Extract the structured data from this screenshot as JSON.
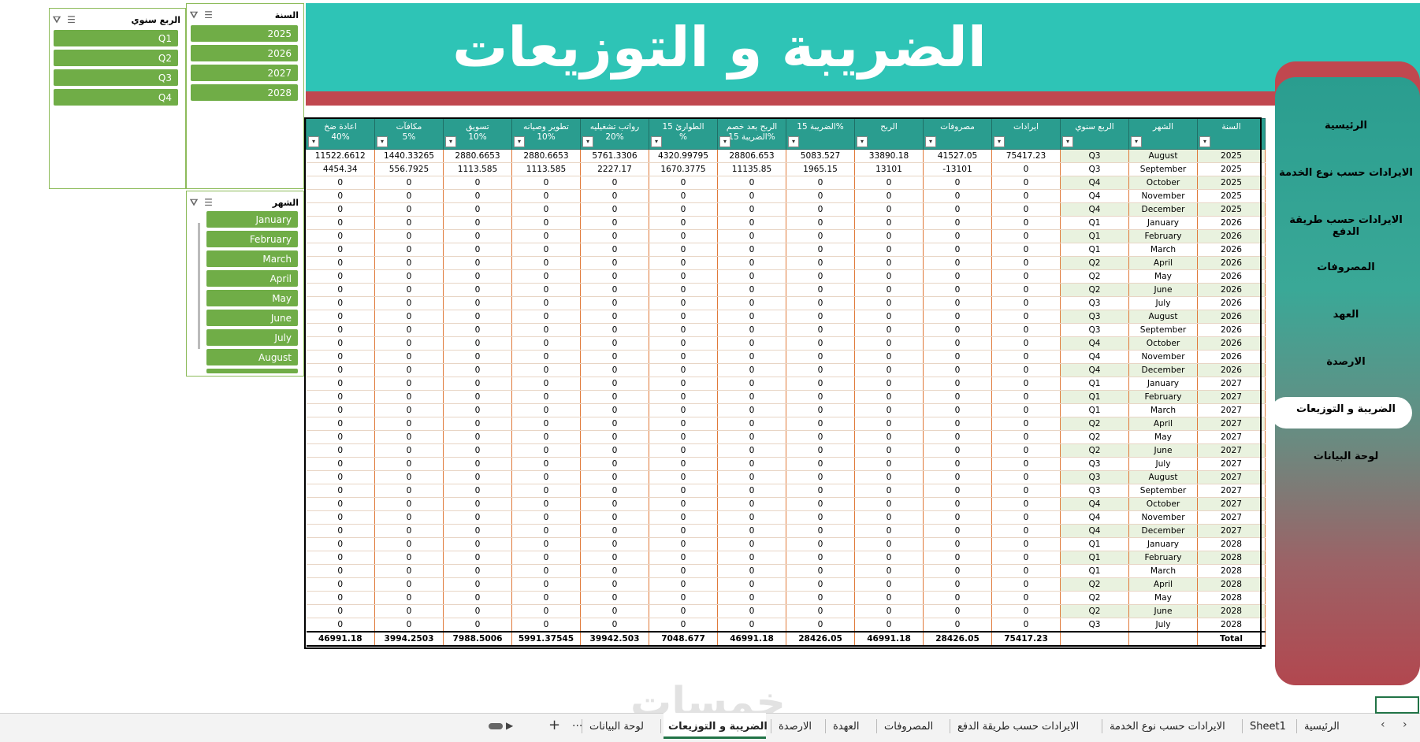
{
  "header": {
    "title": "الضريبة و التوزيعات"
  },
  "slicers": {
    "quarter": {
      "title": "الربع سنوي",
      "items": [
        "Q1",
        "Q2",
        "Q3",
        "Q4"
      ]
    },
    "year": {
      "title": "السنة",
      "items": [
        "2025",
        "2026",
        "2027",
        "2028"
      ]
    },
    "month": {
      "title": "الشهر",
      "items": [
        "January",
        "February",
        "March",
        "April",
        "May",
        "June",
        "July",
        "August"
      ]
    }
  },
  "table": {
    "headers": [
      {
        "l1": "السنة",
        "l2": ""
      },
      {
        "l1": "الشهر",
        "l2": ""
      },
      {
        "l1": "الربع سنوي",
        "l2": ""
      },
      {
        "l1": "ايرادات",
        "l2": ""
      },
      {
        "l1": "مصروفات",
        "l2": ""
      },
      {
        "l1": "الربح",
        "l2": ""
      },
      {
        "l1": "الضريبة 15%",
        "l2": ""
      },
      {
        "l1": "الربح بعد خصم",
        "l2": "الضريبة 15%"
      },
      {
        "l1": "الطوارئ 15",
        "l2": "%"
      },
      {
        "l1": "رواتب تشغيليه",
        "l2": "20%"
      },
      {
        "l1": "تطوير وصيانه",
        "l2": "10%"
      },
      {
        "l1": "تسويق",
        "l2": "10%"
      },
      {
        "l1": "مكافآت",
        "l2": "5%"
      },
      {
        "l1": "اعادة ضخ",
        "l2": "40%"
      }
    ],
    "rows": [
      [
        "2025",
        "August",
        "Q3",
        "75417.23",
        "41527.05",
        "33890.18",
        "5083.527",
        "28806.653",
        "4320.99795",
        "5761.3306",
        "2880.6653",
        "2880.6653",
        "1440.33265",
        "11522.6612"
      ],
      [
        "2025",
        "September",
        "Q3",
        "0",
        "-13101",
        "13101",
        "1965.15",
        "11135.85",
        "1670.3775",
        "2227.17",
        "1113.585",
        "1113.585",
        "556.7925",
        "4454.34"
      ],
      [
        "2025",
        "October",
        "Q4",
        "0",
        "0",
        "0",
        "0",
        "0",
        "0",
        "0",
        "0",
        "0",
        "0",
        "0"
      ],
      [
        "2025",
        "November",
        "Q4",
        "0",
        "0",
        "0",
        "0",
        "0",
        "0",
        "0",
        "0",
        "0",
        "0",
        "0"
      ],
      [
        "2025",
        "December",
        "Q4",
        "0",
        "0",
        "0",
        "0",
        "0",
        "0",
        "0",
        "0",
        "0",
        "0",
        "0"
      ],
      [
        "2026",
        "January",
        "Q1",
        "0",
        "0",
        "0",
        "0",
        "0",
        "0",
        "0",
        "0",
        "0",
        "0",
        "0"
      ],
      [
        "2026",
        "February",
        "Q1",
        "0",
        "0",
        "0",
        "0",
        "0",
        "0",
        "0",
        "0",
        "0",
        "0",
        "0"
      ],
      [
        "2026",
        "March",
        "Q1",
        "0",
        "0",
        "0",
        "0",
        "0",
        "0",
        "0",
        "0",
        "0",
        "0",
        "0"
      ],
      [
        "2026",
        "April",
        "Q2",
        "0",
        "0",
        "0",
        "0",
        "0",
        "0",
        "0",
        "0",
        "0",
        "0",
        "0"
      ],
      [
        "2026",
        "May",
        "Q2",
        "0",
        "0",
        "0",
        "0",
        "0",
        "0",
        "0",
        "0",
        "0",
        "0",
        "0"
      ],
      [
        "2026",
        "June",
        "Q2",
        "0",
        "0",
        "0",
        "0",
        "0",
        "0",
        "0",
        "0",
        "0",
        "0",
        "0"
      ],
      [
        "2026",
        "July",
        "Q3",
        "0",
        "0",
        "0",
        "0",
        "0",
        "0",
        "0",
        "0",
        "0",
        "0",
        "0"
      ],
      [
        "2026",
        "August",
        "Q3",
        "0",
        "0",
        "0",
        "0",
        "0",
        "0",
        "0",
        "0",
        "0",
        "0",
        "0"
      ],
      [
        "2026",
        "September",
        "Q3",
        "0",
        "0",
        "0",
        "0",
        "0",
        "0",
        "0",
        "0",
        "0",
        "0",
        "0"
      ],
      [
        "2026",
        "October",
        "Q4",
        "0",
        "0",
        "0",
        "0",
        "0",
        "0",
        "0",
        "0",
        "0",
        "0",
        "0"
      ],
      [
        "2026",
        "November",
        "Q4",
        "0",
        "0",
        "0",
        "0",
        "0",
        "0",
        "0",
        "0",
        "0",
        "0",
        "0"
      ],
      [
        "2026",
        "December",
        "Q4",
        "0",
        "0",
        "0",
        "0",
        "0",
        "0",
        "0",
        "0",
        "0",
        "0",
        "0"
      ],
      [
        "2027",
        "January",
        "Q1",
        "0",
        "0",
        "0",
        "0",
        "0",
        "0",
        "0",
        "0",
        "0",
        "0",
        "0"
      ],
      [
        "2027",
        "February",
        "Q1",
        "0",
        "0",
        "0",
        "0",
        "0",
        "0",
        "0",
        "0",
        "0",
        "0",
        "0"
      ],
      [
        "2027",
        "March",
        "Q1",
        "0",
        "0",
        "0",
        "0",
        "0",
        "0",
        "0",
        "0",
        "0",
        "0",
        "0"
      ],
      [
        "2027",
        "April",
        "Q2",
        "0",
        "0",
        "0",
        "0",
        "0",
        "0",
        "0",
        "0",
        "0",
        "0",
        "0"
      ],
      [
        "2027",
        "May",
        "Q2",
        "0",
        "0",
        "0",
        "0",
        "0",
        "0",
        "0",
        "0",
        "0",
        "0",
        "0"
      ],
      [
        "2027",
        "June",
        "Q2",
        "0",
        "0",
        "0",
        "0",
        "0",
        "0",
        "0",
        "0",
        "0",
        "0",
        "0"
      ],
      [
        "2027",
        "July",
        "Q3",
        "0",
        "0",
        "0",
        "0",
        "0",
        "0",
        "0",
        "0",
        "0",
        "0",
        "0"
      ],
      [
        "2027",
        "August",
        "Q3",
        "0",
        "0",
        "0",
        "0",
        "0",
        "0",
        "0",
        "0",
        "0",
        "0",
        "0"
      ],
      [
        "2027",
        "September",
        "Q3",
        "0",
        "0",
        "0",
        "0",
        "0",
        "0",
        "0",
        "0",
        "0",
        "0",
        "0"
      ],
      [
        "2027",
        "October",
        "Q4",
        "0",
        "0",
        "0",
        "0",
        "0",
        "0",
        "0",
        "0",
        "0",
        "0",
        "0"
      ],
      [
        "2027",
        "November",
        "Q4",
        "0",
        "0",
        "0",
        "0",
        "0",
        "0",
        "0",
        "0",
        "0",
        "0",
        "0"
      ],
      [
        "2027",
        "December",
        "Q4",
        "0",
        "0",
        "0",
        "0",
        "0",
        "0",
        "0",
        "0",
        "0",
        "0",
        "0"
      ],
      [
        "2028",
        "January",
        "Q1",
        "0",
        "0",
        "0",
        "0",
        "0",
        "0",
        "0",
        "0",
        "0",
        "0",
        "0"
      ],
      [
        "2028",
        "February",
        "Q1",
        "0",
        "0",
        "0",
        "0",
        "0",
        "0",
        "0",
        "0",
        "0",
        "0",
        "0"
      ],
      [
        "2028",
        "March",
        "Q1",
        "0",
        "0",
        "0",
        "0",
        "0",
        "0",
        "0",
        "0",
        "0",
        "0",
        "0"
      ],
      [
        "2028",
        "April",
        "Q2",
        "0",
        "0",
        "0",
        "0",
        "0",
        "0",
        "0",
        "0",
        "0",
        "0",
        "0"
      ],
      [
        "2028",
        "May",
        "Q2",
        "0",
        "0",
        "0",
        "0",
        "0",
        "0",
        "0",
        "0",
        "0",
        "0",
        "0"
      ],
      [
        "2028",
        "June",
        "Q2",
        "0",
        "0",
        "0",
        "0",
        "0",
        "0",
        "0",
        "0",
        "0",
        "0",
        "0"
      ],
      [
        "2028",
        "July",
        "Q3",
        "0",
        "0",
        "0",
        "0",
        "0",
        "0",
        "0",
        "0",
        "0",
        "0",
        "0"
      ]
    ],
    "total": [
      "Total",
      "",
      "",
      "75417.23",
      "28426.05",
      "46991.18",
      "28426.05",
      "46991.18",
      "7048.677",
      "39942.503",
      "5991.37545",
      "7988.5006",
      "3994.2503",
      "46991.18"
    ]
  },
  "nav": {
    "items": [
      "الرئيسية",
      "الايرادات حسب نوع الخدمة",
      "الايرادات حسب طريقة الدفع",
      "المصروفات",
      "العهد",
      "الارصدة",
      "الضريبة و التوزيعات",
      "لوحة البيانات"
    ],
    "active": "الضريبة و التوزيعات"
  },
  "tabs": {
    "items": [
      "الرئيسية",
      "Sheet1",
      "الايرادات حسب  نوع الخدمة",
      "الايرادات حسب طريقة الدفع",
      "المصروفات",
      "العهدة",
      "الارصدة",
      "الضريبة و التوزيعات",
      "لوحة البيانات"
    ],
    "more": "...",
    "add": "+"
  },
  "watermark": "خمسات",
  "colors": {
    "teal": "#2ec4b6",
    "red": "#c0474f",
    "green": "#70ad47",
    "header": "#2a9d8f"
  }
}
